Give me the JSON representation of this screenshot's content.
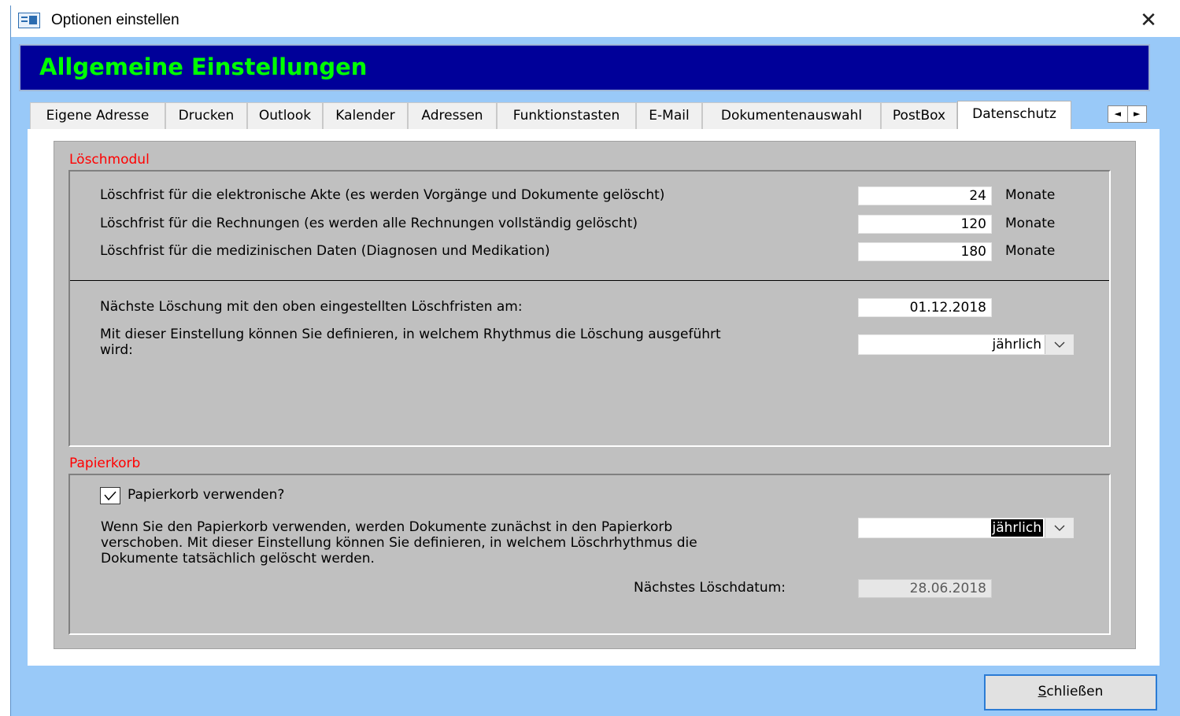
{
  "window": {
    "title": "Optionen einstellen",
    "close_glyph": "✕"
  },
  "header": {
    "title": "Allgemeine Einstellungen"
  },
  "tabs": [
    {
      "label": "Eigene Adresse"
    },
    {
      "label": "Drucken"
    },
    {
      "label": "Outlook"
    },
    {
      "label": "Kalender"
    },
    {
      "label": "Adressen"
    },
    {
      "label": "Funktionstasten"
    },
    {
      "label": "E-Mail"
    },
    {
      "label": "Dokumentenauswahl"
    },
    {
      "label": "PostBox"
    },
    {
      "label": "Datenschutz"
    }
  ],
  "active_tab": "Datenschutz",
  "tab_scroll": {
    "left": "◄",
    "right": "►"
  },
  "loeschmodul": {
    "section_label": "Löschmodul",
    "rows": [
      {
        "label": "Löschfrist für die elektronische Akte (es werden Vorgänge und Dokumente gelöscht)",
        "value": "24",
        "unit": "Monate"
      },
      {
        "label": "Löschfrist für die Rechnungen (es werden alle Rechnungen vollständig gelöscht)",
        "value": "120",
        "unit": "Monate"
      },
      {
        "label": "Löschfrist für die medizinischen Daten (Diagnosen und Medikation)",
        "value": "180",
        "unit": "Monate"
      }
    ],
    "next_deletion_label": "Nächste Löschung mit den oben eingestellten Löschfristen am:",
    "next_deletion_value": "01.12.2018",
    "rhythm_label_line1": "Mit dieser Einstellung können Sie definieren, in welchem Rhythmus die Löschung ausgeführt",
    "rhythm_label_line2": "wird:",
    "rhythm_value": "jährlich"
  },
  "papierkorb": {
    "section_label": "Papierkorb",
    "checkbox_label": "Papierkorb verwenden?",
    "checkbox_checked": true,
    "description_line1": "Wenn Sie den Papierkorb verwenden, werden Dokumente zunächst in den Papierkorb",
    "description_line2": "verschoben. Mit dieser Einstellung können Sie definieren, in welchem Löschrhythmus die",
    "description_line3": "Dokumente tatsächlich gelöscht werden.",
    "rhythm_value": "jährlich",
    "next_date_label": "Nächstes Löschdatum:",
    "next_date_value": "28.06.2018"
  },
  "footer": {
    "close_button_accel": "S",
    "close_button_rest": "chließen"
  },
  "colors": {
    "header_bg": "#000099",
    "header_text": "#00ff00",
    "section_label": "#ff0000",
    "window_bg": "#99c9f8",
    "panel_bg": "#c0c0c0"
  }
}
